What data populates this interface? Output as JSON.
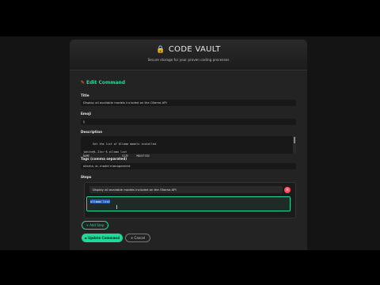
{
  "app": {
    "title": "CODE VAULT",
    "lock_icon": "lock-icon",
    "tagline": "Secure storage for your proven coding processes"
  },
  "form": {
    "title": "Edit Command",
    "title_icon": "pencil-icon",
    "title_label": "Title",
    "title_value": "Display all available models included on the Ollama API",
    "emoji_label": "Emoji",
    "emoji_value": "§",
    "description_label": "Description",
    "description_value": "Get the list of Ollama models installed.\n\njwhite@L-Ilm:~$ ollama list\nNAME                    SIZE     MODIFIED",
    "tags_label": "Tags (comma separated)",
    "tags_value": "ollama, ai, model management",
    "steps_label": "Steps",
    "steps": [
      {
        "description": "Display all available models included on the Ollama API",
        "code": "ollama list",
        "remove_label": "×"
      }
    ],
    "add_step_label": "+ Add Step",
    "update_label": "Update Command",
    "update_icon": "save-icon",
    "cancel_label": "✕ Cancel"
  },
  "colors": {
    "accent": "#1ed99a",
    "danger": "#ff4d5a",
    "lock": "#f0a020",
    "pencil": "#ff8a3d",
    "background": "#232323"
  }
}
